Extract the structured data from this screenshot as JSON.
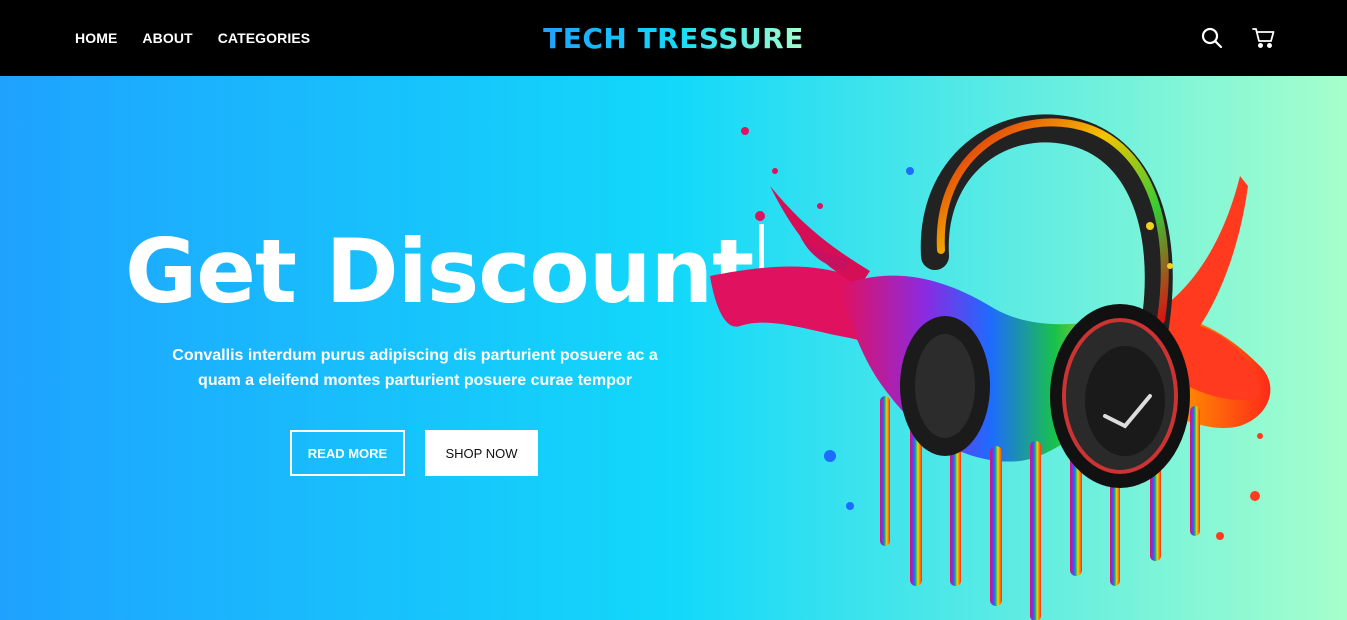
{
  "nav": {
    "links": [
      "HOME",
      "ABOUT",
      "CATEGORIES"
    ],
    "brand": "TECH TRESSURE",
    "icons": [
      "search-icon",
      "cart-icon"
    ]
  },
  "hero": {
    "title": "Get Discount",
    "subtitle_line1": "Convallis interdum purus adipiscing dis parturient posuere ac a",
    "subtitle_line2": "quam a eleifend montes parturient posuere curae tempor",
    "read_more": "READ MORE",
    "shop_now": "SHOP NOW",
    "image": "headphones-paint-splash"
  },
  "colors": {
    "nav_bg": "#000000",
    "gradient_start": "#1fa2ff",
    "gradient_mid": "#12d8fa",
    "gradient_end": "#a6ffcb"
  }
}
